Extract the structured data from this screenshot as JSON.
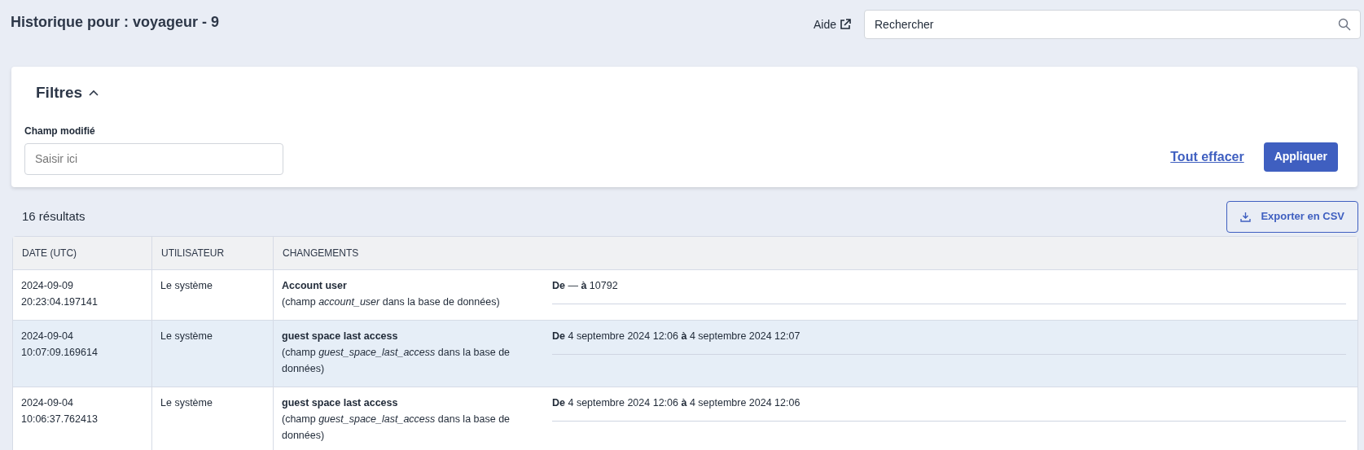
{
  "title": "Historique pour : voyageur - 9",
  "help_link": "Aide",
  "search": {
    "placeholder": "Rechercher"
  },
  "filters": {
    "title": "Filtres",
    "expanded": true,
    "field_label": "Champ modifié",
    "field_placeholder": "Saisir ici",
    "clear": "Tout effacer",
    "apply": "Appliquer"
  },
  "result_count": "16 résultats",
  "export": "Exporter en CSV",
  "table": {
    "columns": [
      "DATE (UTC)",
      "UTILISATEUR",
      "CHANGEMENTS"
    ],
    "rows": [
      {
        "date": [
          "2024-09-09",
          "20:23:04.197141"
        ],
        "user": "Le système",
        "field": "Account user",
        "description": "(champ *account_user* dans la base de données)",
        "change": "**De** — **à** 10792",
        "selected": false
      },
      {
        "date": [
          "2024-09-04",
          "10:07:09.169614"
        ],
        "user": "Le système",
        "field": "guest space last access",
        "description": "(champ *guest_space_last_access* dans la base de données)",
        "change": "**De** 4 septembre 2024 12:06 **à** 4 septembre 2024 12:07",
        "selected": true
      },
      {
        "date": [
          "2024-09-04",
          "10:06:37.762413"
        ],
        "user": "Le système",
        "field": "guest space last access",
        "description": "(champ *guest_space_last_access* dans la base de données)",
        "change": "**De** 4 septembre 2024 12:06 **à** 4 septembre 2024 12:06",
        "selected": false
      }
    ]
  }
}
